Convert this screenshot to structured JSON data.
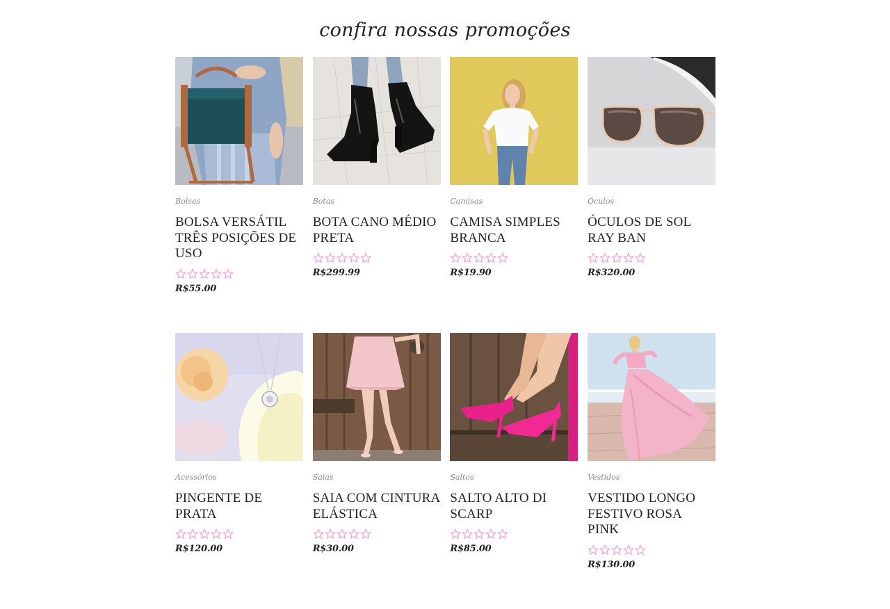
{
  "section": {
    "title": "confira nossas promoções"
  },
  "colors": {
    "star": "#f19ad6",
    "text": "#222222",
    "category": "#8a8a8a"
  },
  "products": [
    {
      "category": "Bolsas",
      "name": "BOLSA VERSÁTIL TRÊS POSIÇÕES DE USO",
      "price": "R$55.00",
      "rating": 0,
      "image": "teal-handbag-photo"
    },
    {
      "category": "Botas",
      "name": "BOTA CANO MÉDIO PRETA",
      "price": "R$299.99",
      "rating": 0,
      "image": "black-patent-boots-photo"
    },
    {
      "category": "Camisas",
      "name": "CAMISA SIMPLES BRANCA",
      "price": "R$19.90",
      "rating": 0,
      "image": "woman-white-tshirt-photo"
    },
    {
      "category": "Óculos",
      "name": "ÓCULOS DE SOL RAY BAN",
      "price": "R$320.00",
      "rating": 0,
      "image": "sunglasses-photo"
    },
    {
      "category": "Acessórios",
      "name": "PINGENTE DE PRATA",
      "price": "R$120.00",
      "rating": 0,
      "image": "silver-pendant-photo"
    },
    {
      "category": "Saias",
      "name": "SAIA COM CINTURA ELÁSTICA",
      "price": "R$30.00",
      "rating": 0,
      "image": "pink-skirt-photo"
    },
    {
      "category": "Saltos",
      "name": "SALTO ALTO DI SCARP",
      "price": "R$85.00",
      "rating": 0,
      "image": "pink-heels-photo"
    },
    {
      "category": "Vestidos",
      "name": "VESTIDO LONGO FESTIVO ROSA PINK",
      "price": "R$130.00",
      "rating": 0,
      "image": "pink-gown-photo"
    }
  ]
}
